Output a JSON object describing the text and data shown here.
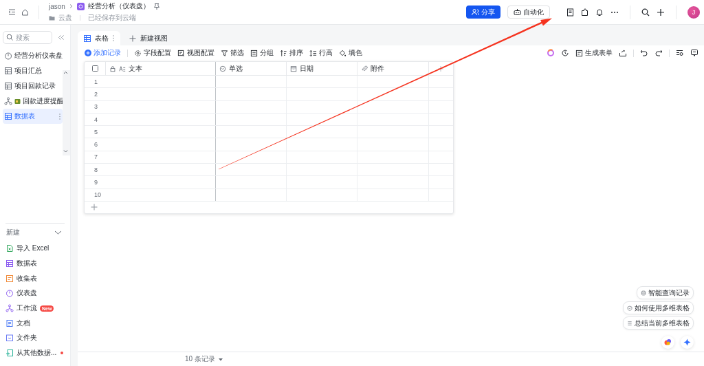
{
  "header": {
    "user": "jason",
    "doc_title": "经营分析（仪表盘）",
    "location": "云盘",
    "save_status": "已经保存到云端",
    "share_button": "分享",
    "automation_button": "自动化",
    "avatar": "J"
  },
  "sidebar": {
    "search": {
      "placeholder": "搜索"
    },
    "items": [
      {
        "label": "经营分析仪表盘",
        "kind": "dashboard",
        "selected": false
      },
      {
        "label": "项目汇总",
        "kind": "table",
        "selected": false
      },
      {
        "label": "项目回款记录",
        "kind": "table",
        "selected": false
      },
      {
        "label": "回款进度提醒",
        "kind": "workflow",
        "marker": true,
        "selected": false
      },
      {
        "label": "数据表",
        "kind": "table",
        "selected": true
      }
    ],
    "create_title": "新建",
    "create_expanded": true,
    "create_items": [
      {
        "label": "导入 Excel",
        "kind": "excel"
      },
      {
        "label": "数据表",
        "kind": "table"
      },
      {
        "label": "收集表",
        "kind": "form"
      },
      {
        "label": "仪表盘",
        "kind": "dashboard"
      },
      {
        "label": "工作流",
        "kind": "workflow",
        "badge": "New"
      },
      {
        "label": "文档",
        "kind": "doc"
      },
      {
        "label": "文件夹",
        "kind": "folder"
      },
      {
        "label": "从其他数据...",
        "kind": "import",
        "dot": true
      }
    ]
  },
  "view_tabs": [
    {
      "label": "表格",
      "kind": "grid",
      "selected": true
    },
    {
      "label": "新建视图",
      "kind": "add",
      "selected": false
    }
  ],
  "toolbar": {
    "add_record": "添加记录",
    "items": [
      {
        "label": "字段配置",
        "kind": "gear"
      },
      {
        "label": "视图配置",
        "kind": "view"
      },
      {
        "label": "筛选",
        "kind": "filter"
      },
      {
        "label": "分组",
        "kind": "group"
      },
      {
        "label": "排序",
        "kind": "sort"
      },
      {
        "label": "行高",
        "kind": "height"
      },
      {
        "label": "填色",
        "kind": "fill"
      }
    ],
    "generate_form": "生成表单"
  },
  "table": {
    "select_all_checked": false,
    "columns": [
      {
        "label": "文本",
        "kind": "text"
      },
      {
        "label": "单选",
        "kind": "select"
      },
      {
        "label": "日期",
        "kind": "date"
      },
      {
        "label": "附件",
        "kind": "attachment"
      }
    ],
    "rows": [
      {
        "number": "1"
      },
      {
        "number": "2"
      },
      {
        "number": "3"
      },
      {
        "number": "4"
      },
      {
        "number": "5"
      },
      {
        "number": "6"
      },
      {
        "number": "7"
      },
      {
        "number": "8"
      },
      {
        "number": "9"
      },
      {
        "number": "10"
      }
    ]
  },
  "footer": {
    "record_count": "10 条记录"
  },
  "assistant": {
    "suggestions": [
      {
        "label": "智能查询记录",
        "kind": "query"
      },
      {
        "label": "如何使用多维表格",
        "kind": "help"
      },
      {
        "label": "总结当前多维表格",
        "kind": "summary"
      }
    ]
  }
}
